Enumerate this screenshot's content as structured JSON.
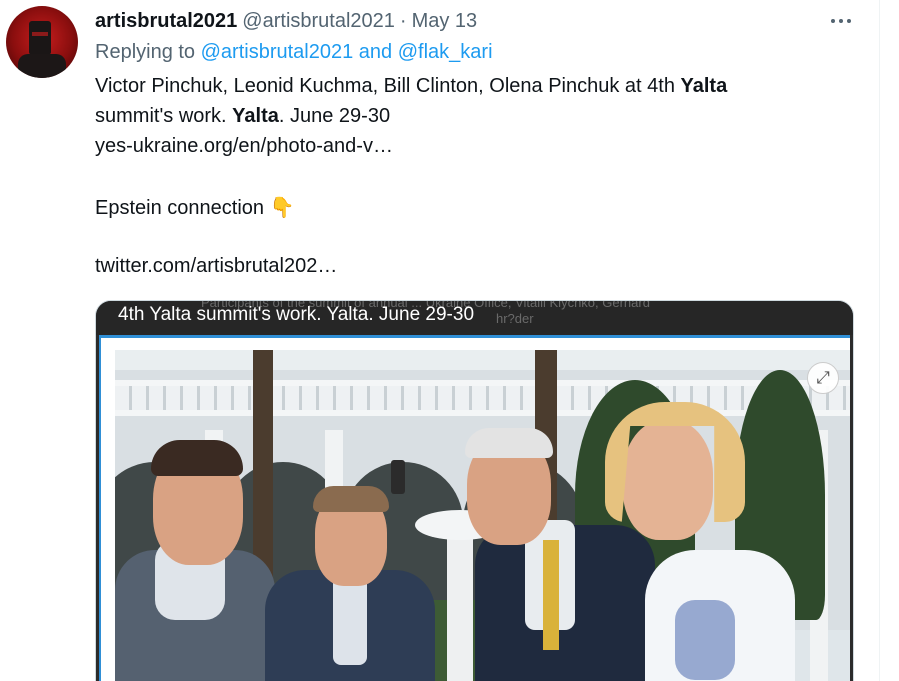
{
  "tweet": {
    "display_name": "artisbrutal2021",
    "handle": "@artisbrutal2021",
    "separator": "·",
    "date": "May 13",
    "reply": {
      "prefix": "Replying to",
      "user1": "@artisbrutal2021",
      "conjunction": "and",
      "user2": "@flak_kari"
    },
    "line1_a": "Victor Pinchuk, Leonid Kuchma, Bill Clinton, Olena Pinchuk at 4th ",
    "line1_b": "Yalta",
    "line2_a": "summit's work. ",
    "line2_b": "Yalta",
    "line2_c": ". June 29-30",
    "link1": "yes-ukraine.org/en/photo-and-v…",
    "epstein_text": "Epstein connection ",
    "emoji": "👇",
    "link2": "twitter.com/artisbrutal202…"
  },
  "card": {
    "title": "4th Yalta summit's work. Yalta. June 29-30",
    "ghost_text_top": "Participants of the summit of annual ... Ukraine Office, Vitalii Klychko, Gerhard",
    "ghost_text_side": "hr?der",
    "expand_icon": "expand-arrows-icon"
  },
  "colors": {
    "link": "#1d9bf0",
    "secondary": "#536471",
    "card_border": "#2f8fd6"
  }
}
